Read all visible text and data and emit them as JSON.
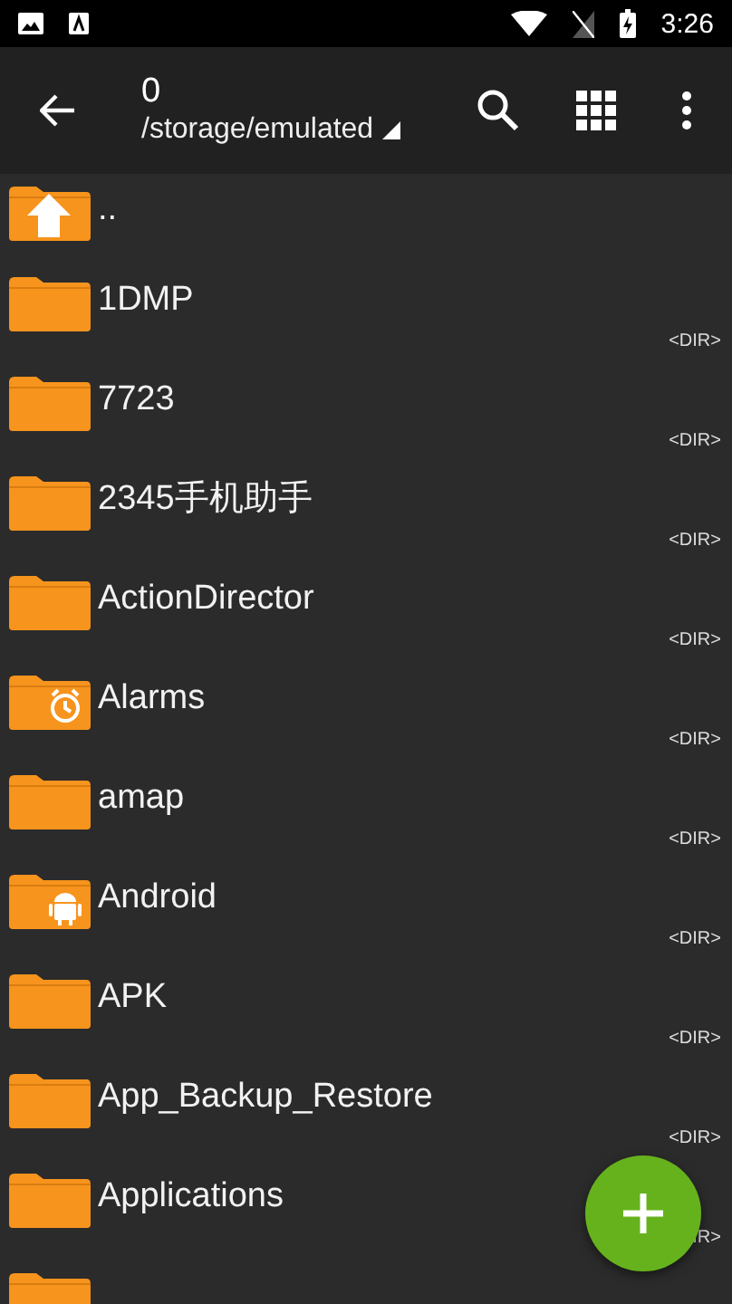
{
  "status_bar": {
    "time": "3:26"
  },
  "toolbar": {
    "title": "0",
    "path": "/storage/emulated"
  },
  "files": [
    {
      "kind": "up",
      "name": ".."
    },
    {
      "kind": "folder",
      "name": "1DMP",
      "type_label": "<DIR>"
    },
    {
      "kind": "folder",
      "name": "7723",
      "type_label": "<DIR>"
    },
    {
      "kind": "folder",
      "name": "2345手机助手",
      "type_label": "<DIR>"
    },
    {
      "kind": "folder",
      "name": "ActionDirector",
      "type_label": "<DIR>"
    },
    {
      "kind": "alarm",
      "name": "Alarms",
      "type_label": "<DIR>"
    },
    {
      "kind": "folder",
      "name": "amap",
      "type_label": "<DIR>"
    },
    {
      "kind": "android",
      "name": "Android",
      "type_label": "<DIR>"
    },
    {
      "kind": "folder",
      "name": "APK",
      "type_label": "<DIR>"
    },
    {
      "kind": "folder",
      "name": "App_Backup_Restore",
      "type_label": "<DIR>"
    },
    {
      "kind": "folder",
      "name": "Applications",
      "type_label": "IR>"
    },
    {
      "kind": "folder"
    }
  ]
}
